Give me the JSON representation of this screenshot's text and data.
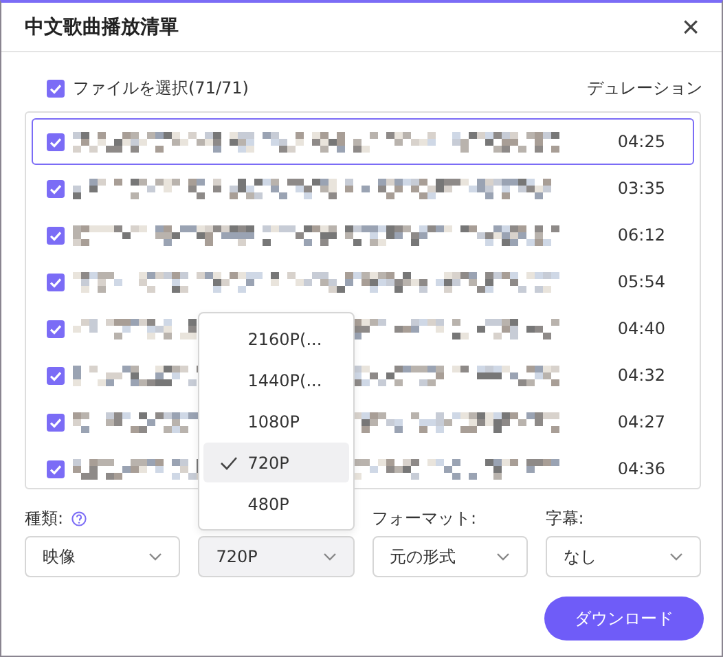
{
  "window": {
    "title": "中文歌曲播放清單",
    "close": "×"
  },
  "list_header": {
    "select_all": {
      "label": "ファイルを選択(71/71)",
      "checked": true
    },
    "duration_heading": "デュレーション"
  },
  "files": [
    {
      "checked": true,
      "selected": true,
      "duration": "04:25"
    },
    {
      "checked": true,
      "selected": false,
      "duration": "03:35"
    },
    {
      "checked": true,
      "selected": false,
      "duration": "06:12"
    },
    {
      "checked": true,
      "selected": false,
      "duration": "05:54"
    },
    {
      "checked": true,
      "selected": false,
      "duration": "04:40"
    },
    {
      "checked": true,
      "selected": false,
      "duration": "04:32"
    },
    {
      "checked": true,
      "selected": false,
      "duration": "04:27"
    },
    {
      "checked": true,
      "selected": false,
      "duration": "04:36"
    }
  ],
  "options": [
    {
      "label": "種類:",
      "help": true,
      "value": "映像",
      "open": false
    },
    {
      "value": "720P",
      "open": true
    },
    {
      "label": "フォーマット:",
      "value": "元の形式",
      "open": false
    },
    {
      "label": "字幕:",
      "value": "なし",
      "open": false
    }
  ],
  "quality_menu": [
    {
      "label": "2160P(...",
      "selected": false
    },
    {
      "label": "1440P(...",
      "selected": false
    },
    {
      "label": "1080P",
      "selected": false
    },
    {
      "label": "720P",
      "selected": true
    },
    {
      "label": "480P",
      "selected": false
    }
  ],
  "download_button": "ダウンロード"
}
